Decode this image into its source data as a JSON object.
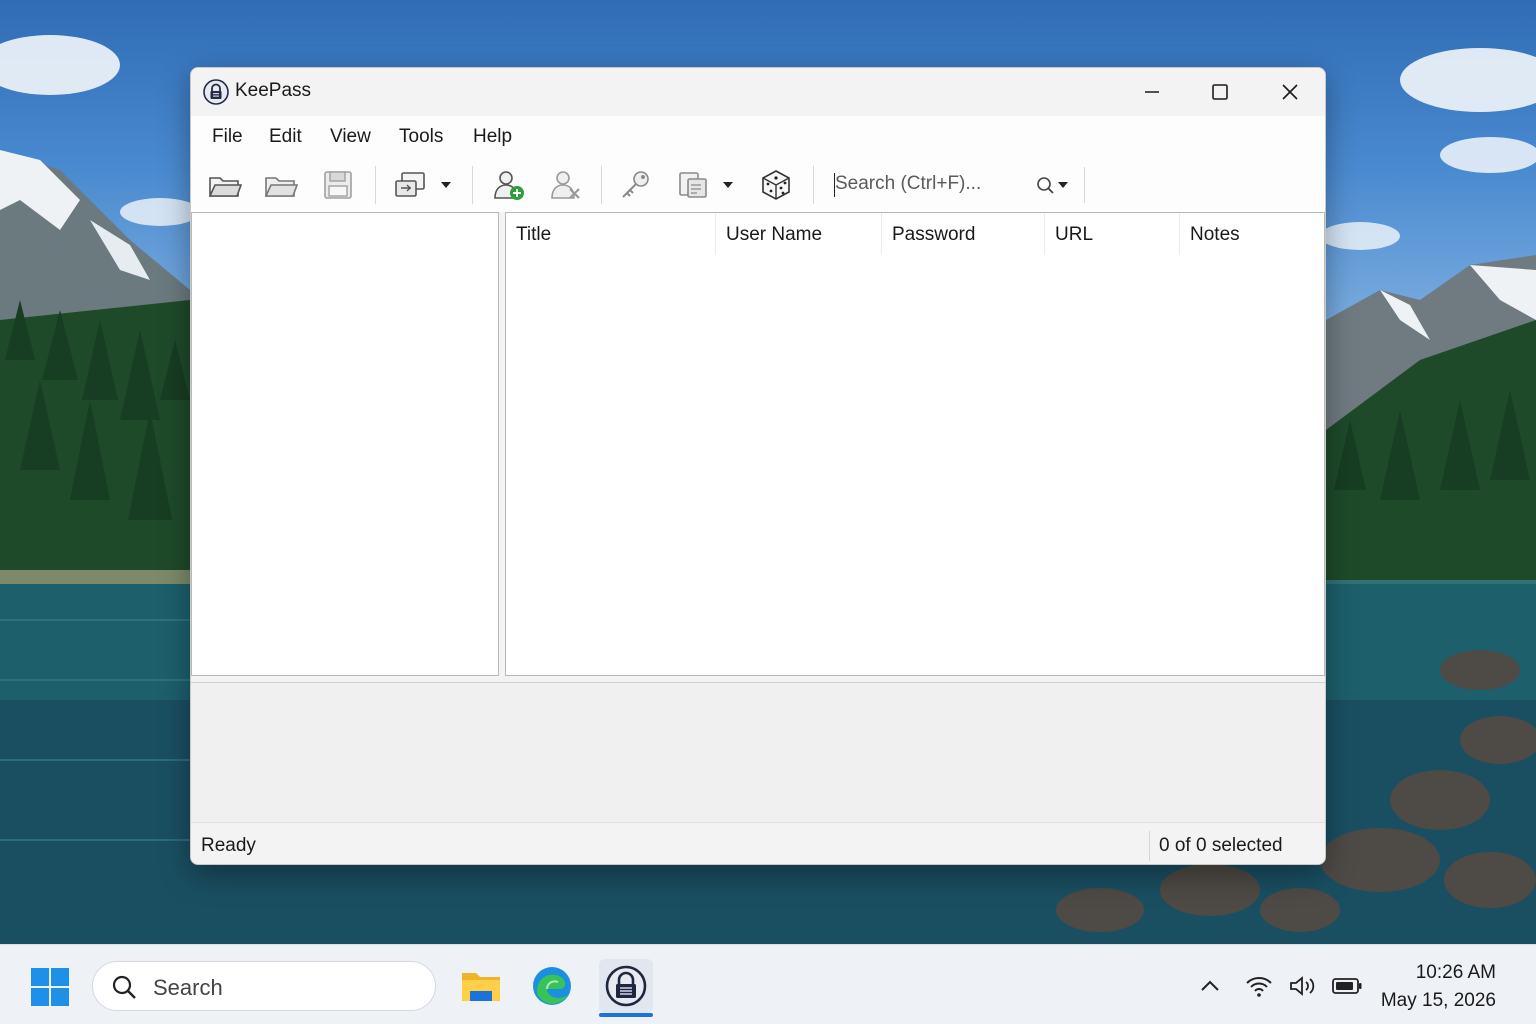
{
  "window": {
    "title": "KeePass",
    "controls": {
      "minimize": "minimize",
      "maximize": "maximize",
      "close": "close"
    }
  },
  "menu": {
    "items": [
      {
        "label": "File"
      },
      {
        "label": "Edit"
      },
      {
        "label": "View"
      },
      {
        "label": "Tools"
      },
      {
        "label": "Help"
      }
    ]
  },
  "toolbar": {
    "buttons": [
      {
        "icon": "new-database-icon"
      },
      {
        "icon": "open-database-icon"
      },
      {
        "icon": "save-icon"
      },
      {
        "icon": "sync-icon"
      },
      {
        "icon": "add-entry-icon"
      },
      {
        "icon": "delete-entry-icon"
      },
      {
        "icon": "key-icon"
      },
      {
        "icon": "copy-icon"
      },
      {
        "icon": "password-generator-dice-icon"
      }
    ],
    "search": {
      "placeholder": "Search (Ctrl+F)..."
    }
  },
  "entries": {
    "columns": [
      "Title",
      "User Name",
      "Password",
      "URL",
      "Notes"
    ],
    "rows": []
  },
  "status": {
    "left": "Ready",
    "right": "0 of 0 selected"
  },
  "taskbar": {
    "search_label": "Search",
    "apps": [
      "file-explorer",
      "edge",
      "keepass"
    ],
    "active_app": "keepass",
    "clock_time": "10:26 AM",
    "clock_date": "May 15, 2026"
  },
  "colors": {
    "accent": "#1a73d9",
    "add_green": "#2e9e3a"
  }
}
